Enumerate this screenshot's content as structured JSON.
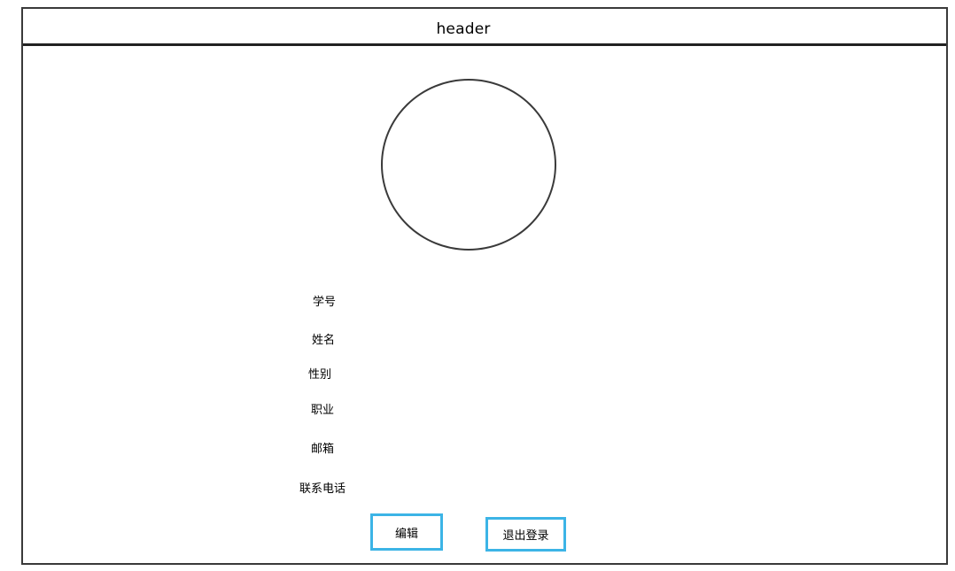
{
  "header": {
    "title": "header"
  },
  "profile": {
    "fields": [
      {
        "label": "学号"
      },
      {
        "label": "姓名"
      },
      {
        "label": "性别"
      },
      {
        "label": "职业"
      },
      {
        "label": "邮箱"
      },
      {
        "label": "联系电话"
      }
    ]
  },
  "actions": {
    "edit_label": "编辑",
    "logout_label": "退出登录"
  },
  "colors": {
    "frame_border": "#3a3a3a",
    "button_border": "#3cb4e6"
  }
}
